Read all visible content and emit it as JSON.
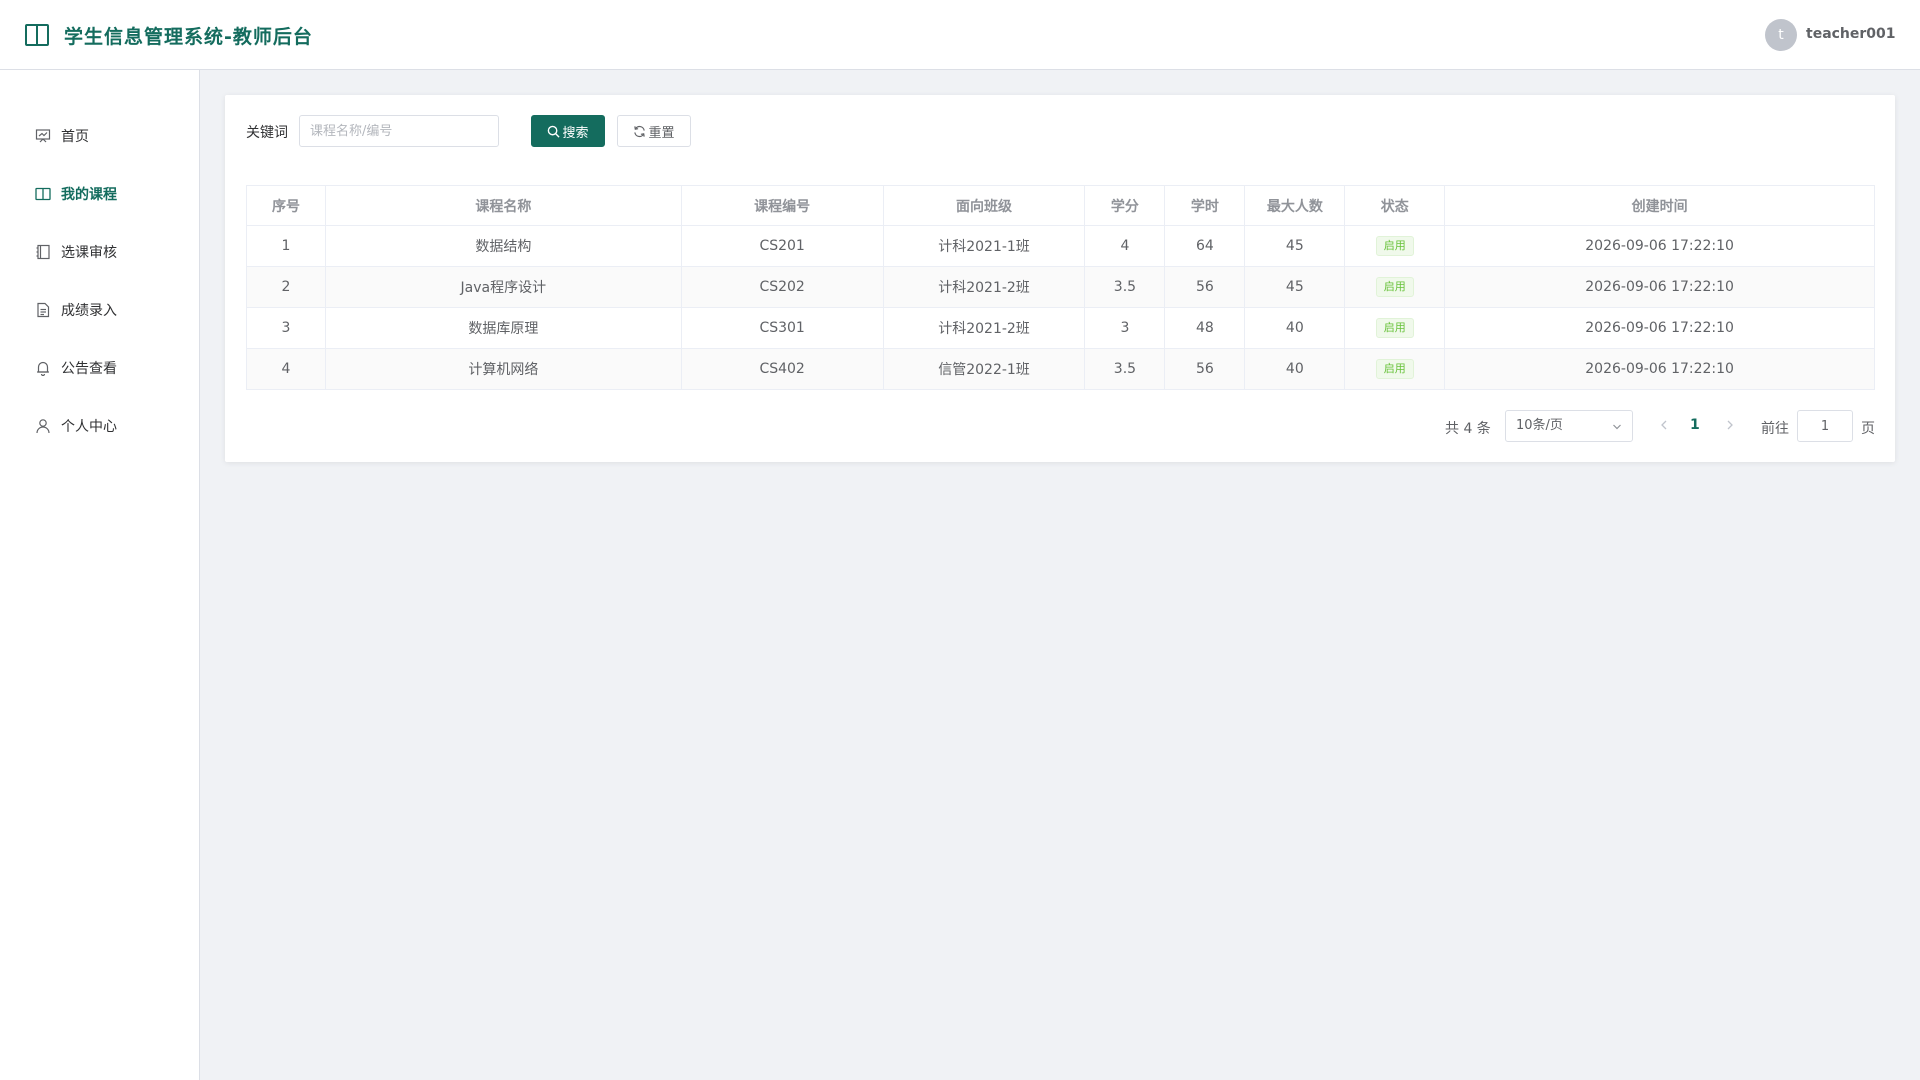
{
  "header": {
    "title": "学生信息管理系统-教师后台",
    "avatar_letter": "t",
    "username": "teacher001"
  },
  "sidebar": {
    "items": [
      {
        "label": "首页",
        "icon": "dashboard-icon",
        "active": false
      },
      {
        "label": "我的课程",
        "icon": "book-icon",
        "active": true
      },
      {
        "label": "选课审核",
        "icon": "notebook-icon",
        "active": false
      },
      {
        "label": "成绩录入",
        "icon": "document-icon",
        "active": false
      },
      {
        "label": "公告查看",
        "icon": "bell-icon",
        "active": false
      },
      {
        "label": "个人中心",
        "icon": "user-icon",
        "active": false
      }
    ]
  },
  "filter": {
    "keyword_label": "关键词",
    "keyword_placeholder": "课程名称/编号",
    "keyword_value": "",
    "search_label": "搜索",
    "reset_label": "重置"
  },
  "table": {
    "columns": [
      "序号",
      "课程名称",
      "课程编号",
      "面向班级",
      "学分",
      "学时",
      "最大人数",
      "状态",
      "创建时间"
    ],
    "rows": [
      [
        "1",
        "数据结构",
        "CS201",
        "计科2021-1班",
        "4",
        "64",
        "45",
        "启用",
        "2026-09-06 17:22:10"
      ],
      [
        "2",
        "Java程序设计",
        "CS202",
        "计科2021-2班",
        "3.5",
        "56",
        "45",
        "启用",
        "2026-09-06 17:22:10"
      ],
      [
        "3",
        "数据库原理",
        "CS301",
        "计科2021-2班",
        "3",
        "48",
        "40",
        "启用",
        "2026-09-06 17:22:10"
      ],
      [
        "4",
        "计算机网络",
        "CS402",
        "信管2022-1班",
        "3.5",
        "56",
        "40",
        "启用",
        "2026-09-06 17:22:10"
      ]
    ]
  },
  "pagination": {
    "total_text": "共 4 条",
    "page_size": "10条/页",
    "current_page": "1",
    "goto_label": "前往",
    "goto_value": "1",
    "page_suffix": "页"
  },
  "colors": {
    "brand": "#146c5e",
    "status_enabled": "#67c23a"
  }
}
